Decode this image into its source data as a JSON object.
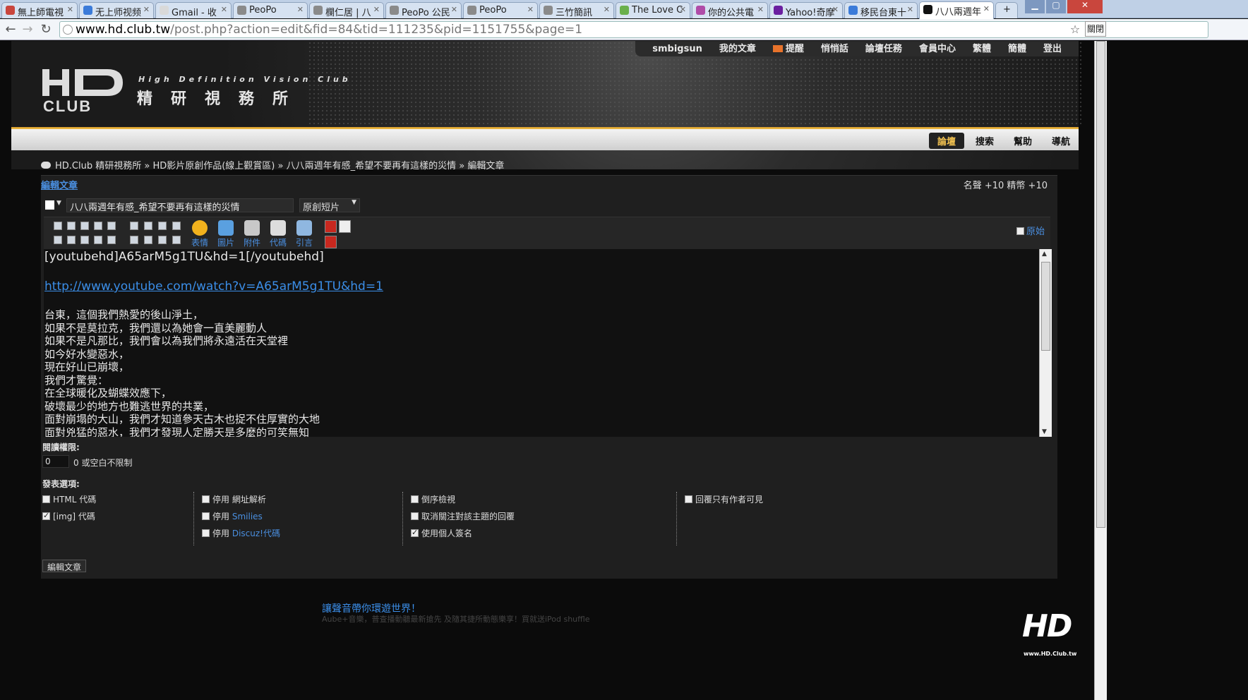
{
  "browser": {
    "tabs": [
      {
        "title": "無上師電視",
        "favicon_color": "#c9463d"
      },
      {
        "title": "无上师视频",
        "favicon_color": "#3b7bd9"
      },
      {
        "title": "Gmail - 收",
        "favicon_color": "#d9d9d9"
      },
      {
        "title": "PeoPo",
        "favicon_color": "#8a8a8a"
      },
      {
        "title": "欄仁居 | 八",
        "favicon_color": "#8a8a8a"
      },
      {
        "title": "PeoPo 公民",
        "favicon_color": "#8a8a8a"
      },
      {
        "title": "PeoPo",
        "favicon_color": "#8a8a8a"
      },
      {
        "title": "三竹簡訊",
        "favicon_color": "#8a8a8a"
      },
      {
        "title": "The Love C",
        "favicon_color": "#6ab04c"
      },
      {
        "title": "你的公共電",
        "favicon_color": "#b04ca8"
      },
      {
        "title": "Yahoo!奇摩",
        "favicon_color": "#6b1fa0"
      },
      {
        "title": "移民台東十",
        "favicon_color": "#3b7bd9"
      },
      {
        "title": "八八兩週年",
        "favicon_color": "#111111"
      }
    ],
    "url_host": "www.hd.club.tw",
    "url_path": "/post.php?action=edit&fid=84&tid=111235&pid=1151755&page=1",
    "ext_label": "關閉"
  },
  "site": {
    "topmenu": [
      "smbigsun",
      "我的文章",
      "提醒",
      "悄悄話",
      "論壇任務",
      "會員中心",
      "繁體",
      "簡體",
      "登出"
    ],
    "logo_sub": "High Definition Vision Club",
    "logo_main": "精研視務所",
    "subnav": [
      "論壇",
      "搜索",
      "幫助",
      "導航"
    ],
    "breadcrumb": "HD.Club 精研視務所 » HD影片原創作品(線上觀賞區) » 八八兩週年有感_希望不要再有這樣的災情 » 編輯文章"
  },
  "form": {
    "panel_title": "編輯文章",
    "credits": "名聲 +10  精幣 +10",
    "subject": "八八兩週年有感_希望不要再有這樣的災情",
    "type": "原創短片",
    "tools": [
      "表情",
      "圖片",
      "附件",
      "代碼",
      "引言"
    ],
    "raw_label": "原始",
    "editor_bbcode": "[youtubehd]A65arM5g1TU&hd=1[/youtubehd]",
    "editor_link": "http://www.youtube.com/watch?v=A65arM5g1TU&hd=1",
    "editor_lines": [
      "台東，這個我們熱愛的後山淨土，",
      "如果不是莫拉克，我們還以為她會一直美麗動人",
      "如果不是凡那比，我們會以為我們將永遠活在天堂裡",
      "如今好水變惡水，",
      "現在好山已崩壞，",
      "我們才驚覺：",
      "在全球暖化及蝴蝶效應下，",
      "破壞最少的地方也難逃世界的共業，",
      "面對崩塌的大山，我們才知道參天古木也捉不住厚實的大地",
      "面對兇猛的惡水，我們才發現人定勝天是多麼的可笑無知"
    ],
    "perm_label": "閱讀權限:",
    "perm_value": "0",
    "perm_hint": "0 或空白不限制",
    "options_label": "發表選項:",
    "options": {
      "col1": [
        {
          "text": "HTML 代碼",
          "checked": false
        },
        {
          "text": "[img] 代碼",
          "checked": true
        }
      ],
      "col2": [
        {
          "pre": "停用",
          "text": "網址解析",
          "link": false,
          "checked": false
        },
        {
          "pre": "停用",
          "text": "Smilies",
          "link": true,
          "checked": false
        },
        {
          "pre": "停用",
          "text": "Discuz!代碼",
          "link": true,
          "checked": false
        }
      ],
      "col3": [
        {
          "text": "倒序檢視",
          "checked": false
        },
        {
          "text": "取消關注對該主題的回覆",
          "checked": false
        },
        {
          "text": "使用個人簽名",
          "checked": true
        }
      ],
      "col4": [
        {
          "text": "回覆只有作者可見",
          "checked": false
        }
      ]
    },
    "submit": "編輯文章"
  },
  "promo": {
    "title": "讓聲音帶你環遊世界！",
    "sub": "Aube+音樂，普查播動聽最新搶先 及隨其捷所動態樂享！買就送iPod shuffle"
  },
  "watermark": {
    "logo": "HD",
    "url": "www.HD.Club.tw"
  }
}
